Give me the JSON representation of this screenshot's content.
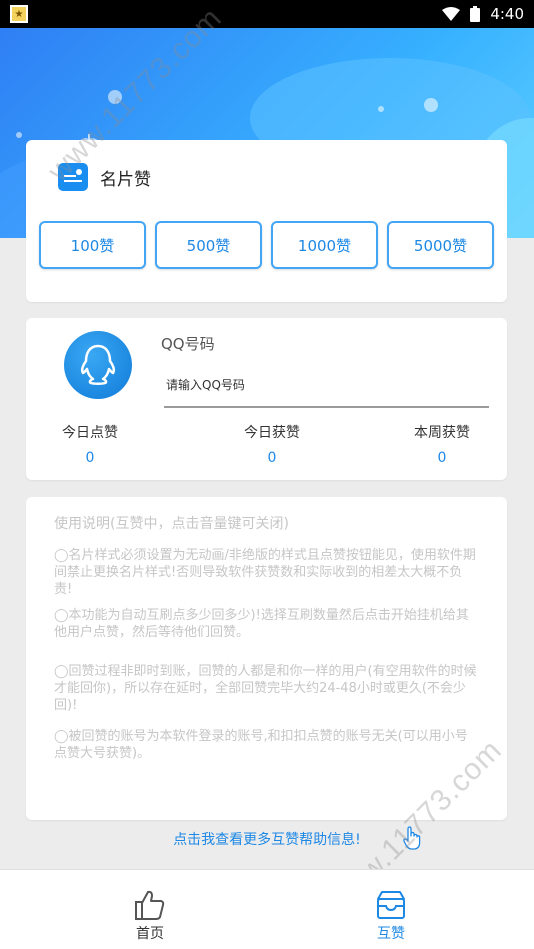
{
  "status_bar": {
    "time": "4:40",
    "icons": [
      "app-star-icon",
      "wifi-icon",
      "battery-icon"
    ]
  },
  "likes_card": {
    "title": "名片赞",
    "icon": "card-icon",
    "options": [
      "100赞",
      "500赞",
      "1000赞",
      "5000赞"
    ]
  },
  "qq_card": {
    "label": "QQ号码",
    "placeholder": "请输入QQ号码",
    "avatar_icon": "qq-penguin-icon",
    "stats": [
      {
        "label": "今日点赞",
        "value": "0"
      },
      {
        "label": "今日获赞",
        "value": "0"
      },
      {
        "label": "本周获赞",
        "value": "0"
      }
    ]
  },
  "help_card": {
    "title": "使用说明(互赞中，点击音量键可关闭)",
    "items": [
      "◯名片样式必须设置为无动画/非绝版的样式且点赞按钮能见，使用软件期间禁止更换名片样式!否则导致软件获赞数和实际收到的相差太大概不负责!",
      "◯本功能为自动互刷点多少回多少)!选择互刷数量然后点击开始挂机给其他用户点赞，然后等待他们回赞。",
      "◯回赞过程非即时到账，回赞的人都是和你一样的用户(有空用软件的时候才能回你)，所以存在延时，全部回赞完毕大约24-48小时或更久(不会少回)!",
      "◯被回赞的账号为本软件登录的账号,和扣扣点赞的账号无关(可以用小号点赞大号获赞)。"
    ]
  },
  "help_link": "点击我查看更多互赞帮助信息!",
  "bottom_nav": {
    "items": [
      {
        "label": "首页",
        "icon": "thumbs-up-icon"
      },
      {
        "label": "互赞",
        "icon": "exchange-box-icon"
      }
    ],
    "active": "互赞"
  },
  "watermark": "www.11773.com",
  "colors": {
    "accent": "#1e88e5",
    "hero_start": "#2f7ff4",
    "hero_end": "#5ed1ff",
    "help_text": "#c6c6c6"
  }
}
